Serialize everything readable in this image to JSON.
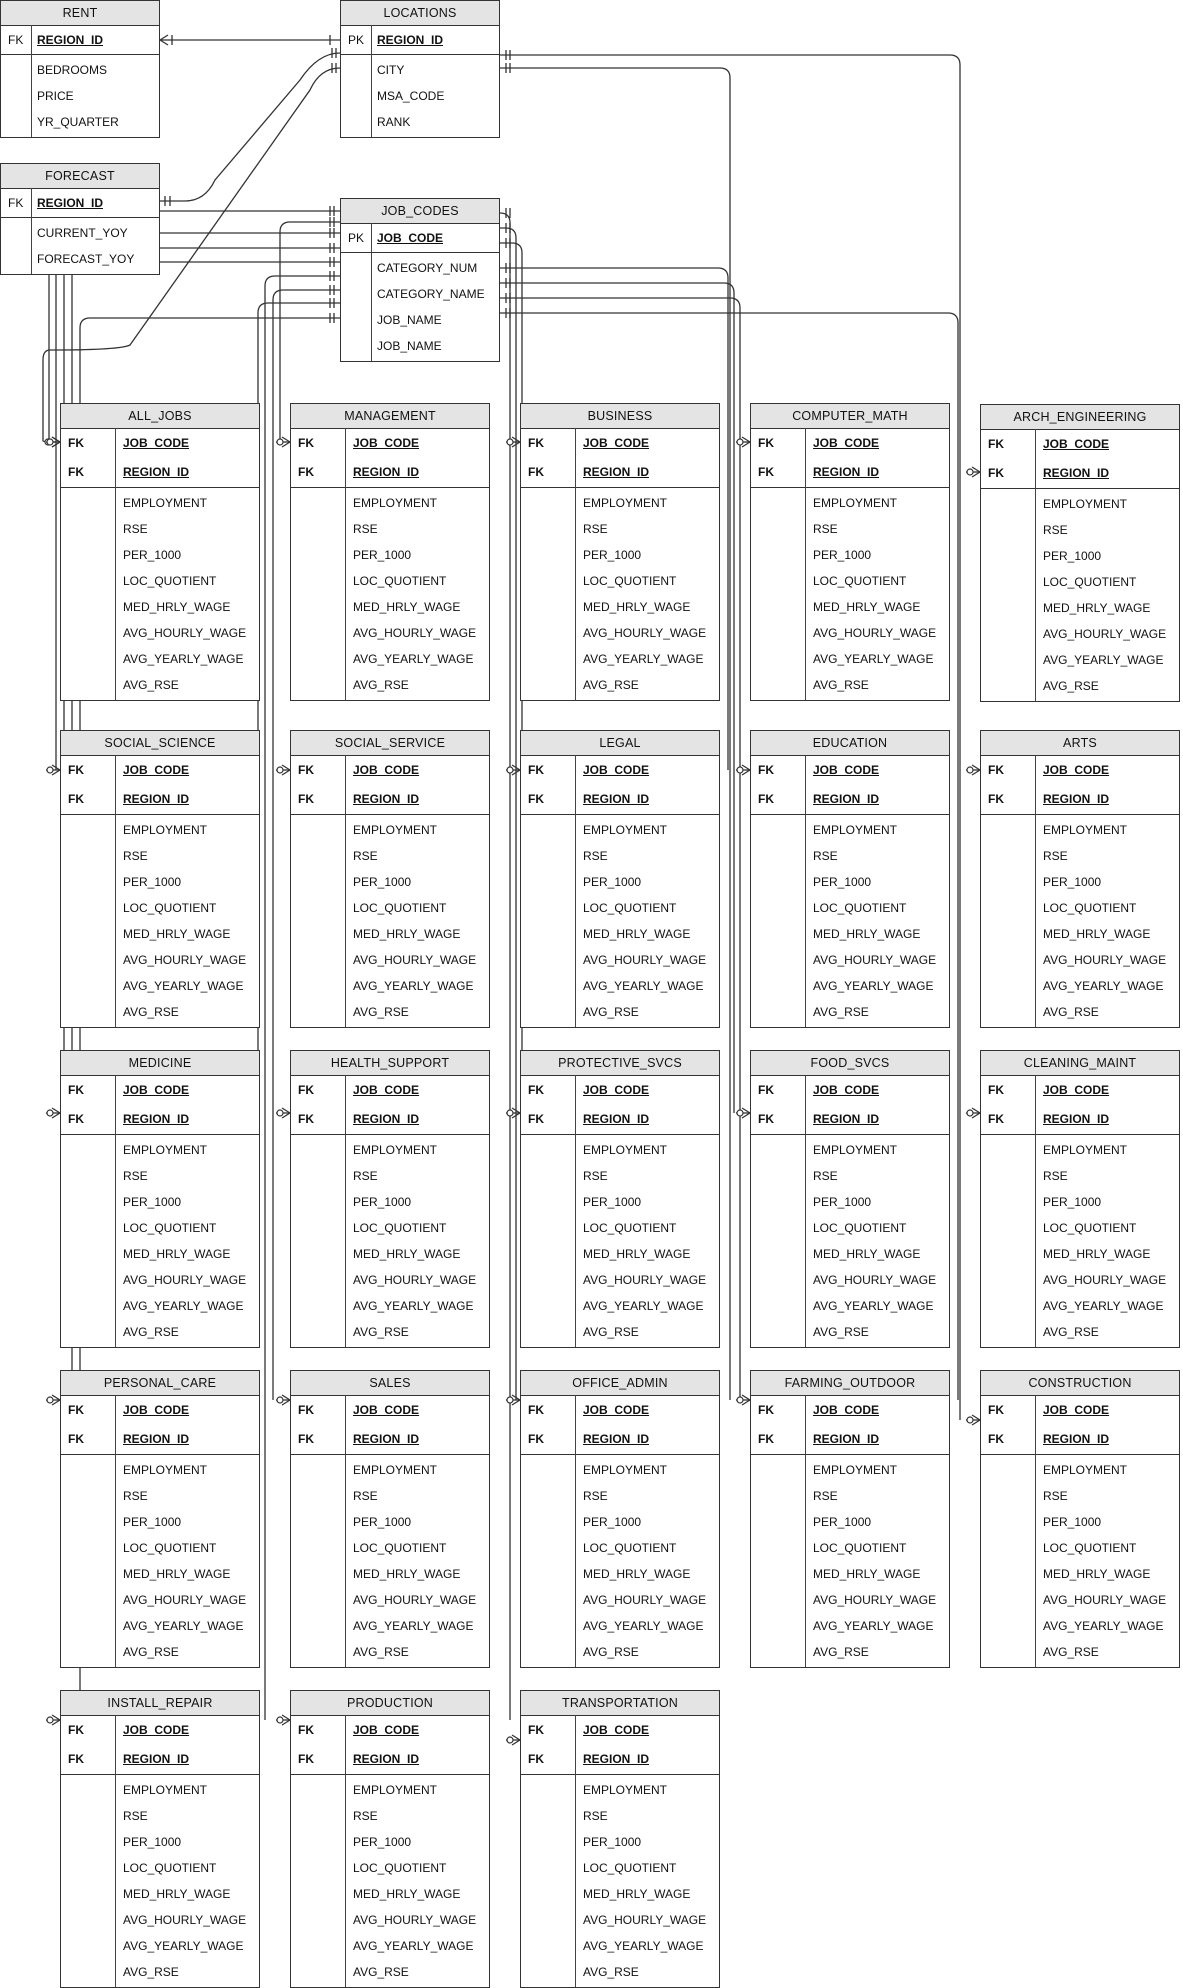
{
  "entities": [
    {
      "name": "RENT",
      "key_type": "FK",
      "key_bold": false,
      "keys": [
        "REGION_ID"
      ],
      "attributes": [
        "BEDROOMS",
        "PRICE",
        "YR_QUARTER"
      ]
    },
    {
      "name": "LOCATIONS",
      "key_type": "PK",
      "key_bold": false,
      "keys": [
        "REGION_ID"
      ],
      "attributes": [
        "CITY",
        "MSA_CODE",
        "RANK"
      ]
    },
    {
      "name": "FORECAST",
      "key_type": "FK",
      "key_bold": false,
      "keys": [
        "REGION_ID"
      ],
      "attributes": [
        "CURRENT_YOY",
        "FORECAST_YOY"
      ]
    },
    {
      "name": "JOB_CODES",
      "key_type": "PK",
      "key_bold": false,
      "keys": [
        "JOB_CODE"
      ],
      "attributes": [
        "CATEGORY_NUM",
        "CATEGORY_NAME",
        "JOB_NAME",
        "JOB_NAME"
      ]
    },
    {
      "name": "ALL_JOBS",
      "key_type": "FK",
      "key_bold": true,
      "keys": [
        "JOB_CODE",
        "REGION_ID"
      ],
      "attributes": [
        "EMPLOYMENT",
        "RSE",
        "PER_1000",
        "LOC_QUOTIENT",
        "MED_HRLY_WAGE",
        "AVG_HOURLY_WAGE",
        "AVG_YEARLY_WAGE",
        "AVG_RSE"
      ]
    },
    {
      "name": "MANAGEMENT",
      "key_type": "FK",
      "key_bold": true,
      "keys": [
        "JOB_CODE",
        "REGION_ID"
      ],
      "attributes": [
        "EMPLOYMENT",
        "RSE",
        "PER_1000",
        "LOC_QUOTIENT",
        "MED_HRLY_WAGE",
        "AVG_HOURLY_WAGE",
        "AVG_YEARLY_WAGE",
        "AVG_RSE"
      ]
    },
    {
      "name": "BUSINESS",
      "key_type": "FK",
      "key_bold": true,
      "keys": [
        "JOB_CODE",
        "REGION_ID"
      ],
      "attributes": [
        "EMPLOYMENT",
        "RSE",
        "PER_1000",
        "LOC_QUOTIENT",
        "MED_HRLY_WAGE",
        "AVG_HOURLY_WAGE",
        "AVG_YEARLY_WAGE",
        "AVG_RSE"
      ]
    },
    {
      "name": "COMPUTER_MATH",
      "key_type": "FK",
      "key_bold": true,
      "keys": [
        "JOB_CODE",
        "REGION_ID"
      ],
      "attributes": [
        "EMPLOYMENT",
        "RSE",
        "PER_1000",
        "LOC_QUOTIENT",
        "MED_HRLY_WAGE",
        "AVG_HOURLY_WAGE",
        "AVG_YEARLY_WAGE",
        "AVG_RSE"
      ]
    },
    {
      "name": "ARCH_ENGINEERING",
      "key_type": "FK",
      "key_bold": true,
      "keys": [
        "JOB_CODE",
        "REGION_ID"
      ],
      "attributes": [
        "EMPLOYMENT",
        "RSE",
        "PER_1000",
        "LOC_QUOTIENT",
        "MED_HRLY_WAGE",
        "AVG_HOURLY_WAGE",
        "AVG_YEARLY_WAGE",
        "AVG_RSE"
      ]
    },
    {
      "name": "SOCIAL_SCIENCE",
      "key_type": "FK",
      "key_bold": true,
      "keys": [
        "JOB_CODE",
        "REGION_ID"
      ],
      "attributes": [
        "EMPLOYMENT",
        "RSE",
        "PER_1000",
        "LOC_QUOTIENT",
        "MED_HRLY_WAGE",
        "AVG_HOURLY_WAGE",
        "AVG_YEARLY_WAGE",
        "AVG_RSE"
      ]
    },
    {
      "name": "SOCIAL_SERVICE",
      "key_type": "FK",
      "key_bold": true,
      "keys": [
        "JOB_CODE",
        "REGION_ID"
      ],
      "attributes": [
        "EMPLOYMENT",
        "RSE",
        "PER_1000",
        "LOC_QUOTIENT",
        "MED_HRLY_WAGE",
        "AVG_HOURLY_WAGE",
        "AVG_YEARLY_WAGE",
        "AVG_RSE"
      ]
    },
    {
      "name": "LEGAL",
      "key_type": "FK",
      "key_bold": true,
      "keys": [
        "JOB_CODE",
        "REGION_ID"
      ],
      "attributes": [
        "EMPLOYMENT",
        "RSE",
        "PER_1000",
        "LOC_QUOTIENT",
        "MED_HRLY_WAGE",
        "AVG_HOURLY_WAGE",
        "AVG_YEARLY_WAGE",
        "AVG_RSE"
      ]
    },
    {
      "name": "EDUCATION",
      "key_type": "FK",
      "key_bold": true,
      "keys": [
        "JOB_CODE",
        "REGION_ID"
      ],
      "attributes": [
        "EMPLOYMENT",
        "RSE",
        "PER_1000",
        "LOC_QUOTIENT",
        "MED_HRLY_WAGE",
        "AVG_HOURLY_WAGE",
        "AVG_YEARLY_WAGE",
        "AVG_RSE"
      ]
    },
    {
      "name": "ARTS",
      "key_type": "FK",
      "key_bold": true,
      "keys": [
        "JOB_CODE",
        "REGION_ID"
      ],
      "attributes": [
        "EMPLOYMENT",
        "RSE",
        "PER_1000",
        "LOC_QUOTIENT",
        "MED_HRLY_WAGE",
        "AVG_HOURLY_WAGE",
        "AVG_YEARLY_WAGE",
        "AVG_RSE"
      ]
    },
    {
      "name": "MEDICINE",
      "key_type": "FK",
      "key_bold": true,
      "keys": [
        "JOB_CODE",
        "REGION_ID"
      ],
      "attributes": [
        "EMPLOYMENT",
        "RSE",
        "PER_1000",
        "LOC_QUOTIENT",
        "MED_HRLY_WAGE",
        "AVG_HOURLY_WAGE",
        "AVG_YEARLY_WAGE",
        "AVG_RSE"
      ]
    },
    {
      "name": "HEALTH_SUPPORT",
      "key_type": "FK",
      "key_bold": true,
      "keys": [
        "JOB_CODE",
        "REGION_ID"
      ],
      "attributes": [
        "EMPLOYMENT",
        "RSE",
        "PER_1000",
        "LOC_QUOTIENT",
        "MED_HRLY_WAGE",
        "AVG_HOURLY_WAGE",
        "AVG_YEARLY_WAGE",
        "AVG_RSE"
      ]
    },
    {
      "name": "PROTECTIVE_SVCS",
      "key_type": "FK",
      "key_bold": true,
      "keys": [
        "JOB_CODE",
        "REGION_ID"
      ],
      "attributes": [
        "EMPLOYMENT",
        "RSE",
        "PER_1000",
        "LOC_QUOTIENT",
        "MED_HRLY_WAGE",
        "AVG_HOURLY_WAGE",
        "AVG_YEARLY_WAGE",
        "AVG_RSE"
      ]
    },
    {
      "name": "FOOD_SVCS",
      "key_type": "FK",
      "key_bold": true,
      "keys": [
        "JOB_CODE",
        "REGION_ID"
      ],
      "attributes": [
        "EMPLOYMENT",
        "RSE",
        "PER_1000",
        "LOC_QUOTIENT",
        "MED_HRLY_WAGE",
        "AVG_HOURLY_WAGE",
        "AVG_YEARLY_WAGE",
        "AVG_RSE"
      ]
    },
    {
      "name": "CLEANING_MAINT",
      "key_type": "FK",
      "key_bold": true,
      "keys": [
        "JOB_CODE",
        "REGION_ID"
      ],
      "attributes": [
        "EMPLOYMENT",
        "RSE",
        "PER_1000",
        "LOC_QUOTIENT",
        "MED_HRLY_WAGE",
        "AVG_HOURLY_WAGE",
        "AVG_YEARLY_WAGE",
        "AVG_RSE"
      ]
    },
    {
      "name": "PERSONAL_CARE",
      "key_type": "FK",
      "key_bold": true,
      "keys": [
        "JOB_CODE",
        "REGION_ID"
      ],
      "attributes": [
        "EMPLOYMENT",
        "RSE",
        "PER_1000",
        "LOC_QUOTIENT",
        "MED_HRLY_WAGE",
        "AVG_HOURLY_WAGE",
        "AVG_YEARLY_WAGE",
        "AVG_RSE"
      ]
    },
    {
      "name": "SALES",
      "key_type": "FK",
      "key_bold": true,
      "keys": [
        "JOB_CODE",
        "REGION_ID"
      ],
      "attributes": [
        "EMPLOYMENT",
        "RSE",
        "PER_1000",
        "LOC_QUOTIENT",
        "MED_HRLY_WAGE",
        "AVG_HOURLY_WAGE",
        "AVG_YEARLY_WAGE",
        "AVG_RSE"
      ]
    },
    {
      "name": "OFFICE_ADMIN",
      "key_type": "FK",
      "key_bold": true,
      "keys": [
        "JOB_CODE",
        "REGION_ID"
      ],
      "attributes": [
        "EMPLOYMENT",
        "RSE",
        "PER_1000",
        "LOC_QUOTIENT",
        "MED_HRLY_WAGE",
        "AVG_HOURLY_WAGE",
        "AVG_YEARLY_WAGE",
        "AVG_RSE"
      ]
    },
    {
      "name": "FARMING_OUTDOOR",
      "key_type": "FK",
      "key_bold": true,
      "keys": [
        "JOB_CODE",
        "REGION_ID"
      ],
      "attributes": [
        "EMPLOYMENT",
        "RSE",
        "PER_1000",
        "LOC_QUOTIENT",
        "MED_HRLY_WAGE",
        "AVG_HOURLY_WAGE",
        "AVG_YEARLY_WAGE",
        "AVG_RSE"
      ]
    },
    {
      "name": "CONSTRUCTION",
      "key_type": "FK",
      "key_bold": true,
      "keys": [
        "JOB_CODE",
        "REGION_ID"
      ],
      "attributes": [
        "EMPLOYMENT",
        "RSE",
        "PER_1000",
        "LOC_QUOTIENT",
        "MED_HRLY_WAGE",
        "AVG_HOURLY_WAGE",
        "AVG_YEARLY_WAGE",
        "AVG_RSE"
      ]
    },
    {
      "name": "INSTALL_REPAIR",
      "key_type": "FK",
      "key_bold": true,
      "keys": [
        "JOB_CODE",
        "REGION_ID"
      ],
      "attributes": [
        "EMPLOYMENT",
        "RSE",
        "PER_1000",
        "LOC_QUOTIENT",
        "MED_HRLY_WAGE",
        "AVG_HOURLY_WAGE",
        "AVG_YEARLY_WAGE",
        "AVG_RSE"
      ]
    },
    {
      "name": "PRODUCTION",
      "key_type": "FK",
      "key_bold": true,
      "keys": [
        "JOB_CODE",
        "REGION_ID"
      ],
      "attributes": [
        "EMPLOYMENT",
        "RSE",
        "PER_1000",
        "LOC_QUOTIENT",
        "MED_HRLY_WAGE",
        "AVG_HOURLY_WAGE",
        "AVG_YEARLY_WAGE",
        "AVG_RSE"
      ]
    },
    {
      "name": "TRANSPORTATION",
      "key_type": "FK",
      "key_bold": true,
      "keys": [
        "JOB_CODE",
        "REGION_ID"
      ],
      "attributes": [
        "EMPLOYMENT",
        "RSE",
        "PER_1000",
        "LOC_QUOTIENT",
        "MED_HRLY_WAGE",
        "AVG_HOURLY_WAGE",
        "AVG_YEARLY_WAGE",
        "AVG_RSE"
      ]
    }
  ],
  "relationships": [
    {
      "from": "LOCATIONS",
      "to": "RENT",
      "from_end": "one-and-only-one",
      "to_end": "one-or-many"
    },
    {
      "from": "LOCATIONS",
      "to": "FORECAST",
      "from_end": "one-and-only-one",
      "to_end": "one-and-only-one"
    },
    {
      "from": "LOCATIONS",
      "to": "ALL_JOBS",
      "from_end": "one-and-only-one",
      "to_end": "zero-or-many"
    },
    {
      "from": "JOB_CODES",
      "to": "ALL_JOBS",
      "from_end": "one-and-only-one",
      "to_end": "zero-or-many"
    },
    {
      "from": "JOB_CODES",
      "to": "MANAGEMENT",
      "from_end": "one-and-only-one",
      "to_end": "zero-or-many"
    },
    {
      "from": "JOB_CODES",
      "to": "BUSINESS",
      "from_end": "one-and-only-one",
      "to_end": "zero-or-many"
    },
    {
      "from": "JOB_CODES",
      "to": "COMPUTER_MATH",
      "from_end": "one-and-only-one",
      "to_end": "zero-or-many"
    },
    {
      "from": "JOB_CODES",
      "to": "ARCH_ENGINEERING",
      "from_end": "one-and-only-one",
      "to_end": "zero-or-many"
    }
  ]
}
